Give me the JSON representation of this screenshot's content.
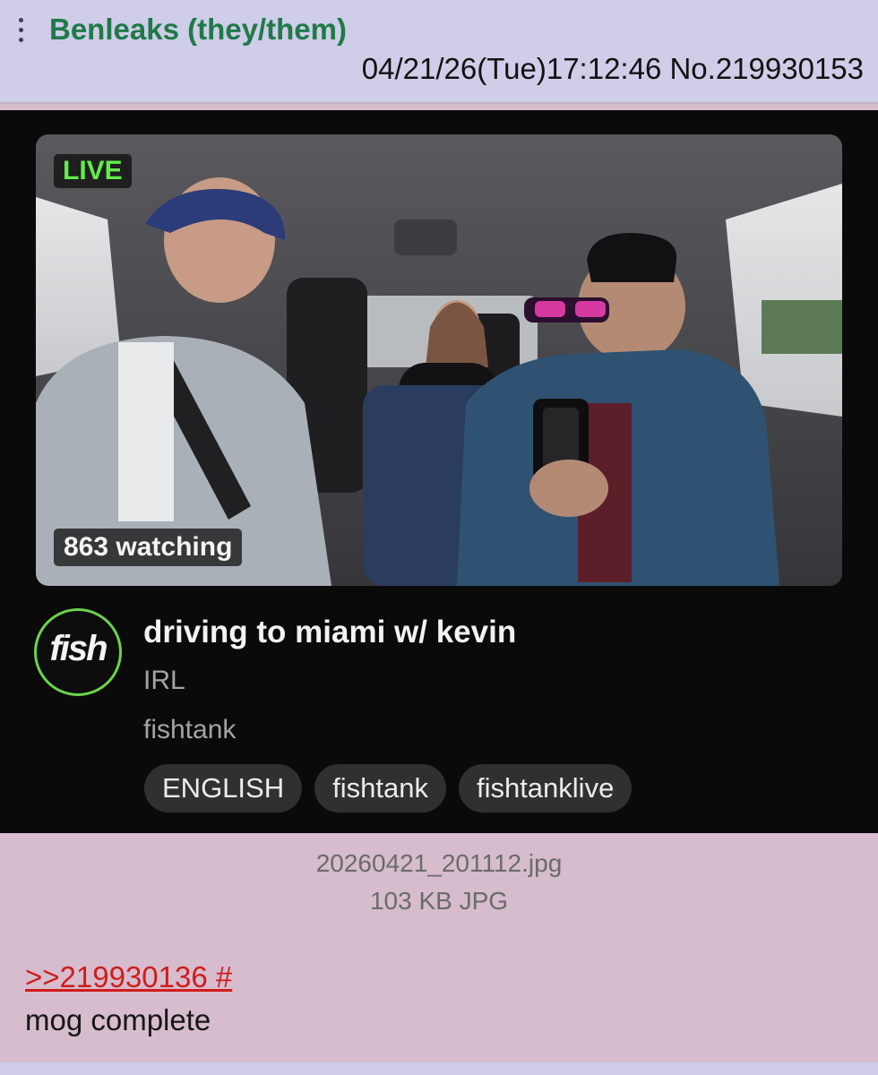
{
  "post": {
    "poster_name": "Benleaks (they/them)",
    "meta": "04/21/26(Tue)17:12:46 No.219930153",
    "file_name": "20260421_201112.jpg",
    "file_info": "103 KB JPG",
    "quote_link": ">>219930136 #",
    "comment": "mog complete"
  },
  "stream": {
    "live_label": "LIVE",
    "viewers": "863 watching",
    "logo_text": "fish",
    "title": "driving to miami w/ kevin",
    "category": "IRL",
    "channel": "fishtank",
    "tags": [
      "ENGLISH",
      "fishtank",
      "fishtanklive"
    ]
  },
  "colors": {
    "header_bg": "#cfcde8",
    "post_bg": "#d6bccc",
    "name_green": "#1f7a48",
    "link_red": "#d01c1c",
    "live_green": "#63ec4b",
    "logo_ring": "#6cd34e",
    "stream_bg": "#0a0a0a"
  },
  "icons": {
    "menu": "vertical-dots-icon"
  }
}
